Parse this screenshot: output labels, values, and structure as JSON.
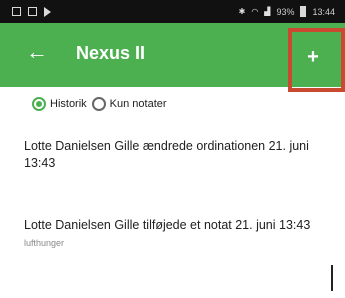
{
  "status_bar": {
    "time": "13:44",
    "battery": "93%"
  },
  "app_bar": {
    "title": "Nexus II",
    "back_icon": "←",
    "add_icon": "+"
  },
  "filters": [
    {
      "label": "Historik",
      "checked": true
    },
    {
      "label": "Kun notater",
      "checked": false
    }
  ],
  "entries": [
    {
      "text": "Lotte Danielsen Gille ændrede ordinationen 21. juni 13:43",
      "note": ""
    },
    {
      "text": "Lotte Danielsen Gille tilføjede et notat 21. juni 13:43",
      "note": "lufthunger"
    }
  ],
  "colors": {
    "app_bar": "#4caf50",
    "highlight": "#c94a30",
    "status_bar": "#111111"
  }
}
